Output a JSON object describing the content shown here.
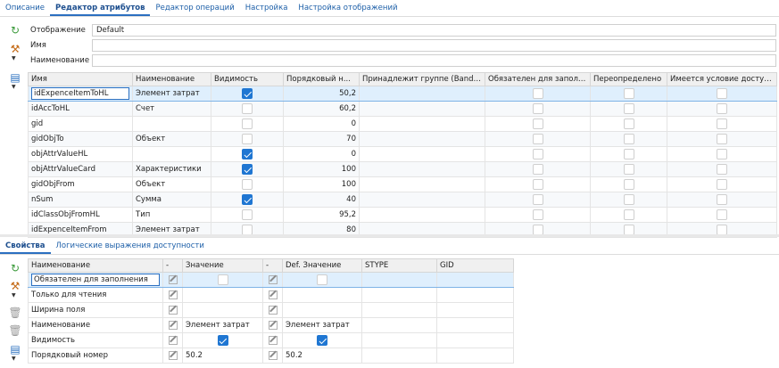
{
  "top_tabs": [
    {
      "label": "Описание",
      "active": false
    },
    {
      "label": "Редактор атрибутов",
      "active": true
    },
    {
      "label": "Редактор операций",
      "active": false
    },
    {
      "label": "Настройка",
      "active": false
    },
    {
      "label": "Настройка отображений",
      "active": false
    }
  ],
  "form": {
    "display_label": "Отображение",
    "display_value": "Default",
    "name_label": "Имя",
    "name_value": "",
    "title_label": "Наименование",
    "title_value": ""
  },
  "toolbar_top": {
    "icons": [
      "refresh-icon",
      "tools-icon",
      "export-icon"
    ]
  },
  "attr_grid": {
    "columns": [
      "Имя",
      "Наименование",
      "Видимость",
      "Порядковый н...",
      "Принадлежит группе (BandGr...",
      "Обязателен для заполне...",
      "Переопределено",
      "Имеется условие доступн..."
    ],
    "rows": [
      {
        "name": "idExpenceItemToHL",
        "title": "Элемент затрат",
        "visible": true,
        "order": "50,2"
      },
      {
        "name": "idAccToHL",
        "title": "Счет",
        "visible": false,
        "order": "60,2"
      },
      {
        "name": "gid",
        "title": "",
        "visible": false,
        "order": "0"
      },
      {
        "name": "gidObjTo",
        "title": "Объект",
        "visible": false,
        "order": "70"
      },
      {
        "name": "objAttrValueHL",
        "title": "",
        "visible": true,
        "order": "0"
      },
      {
        "name": "objAttrValueCard",
        "title": "Характеристики",
        "visible": true,
        "order": "100"
      },
      {
        "name": "gidObjFrom",
        "title": "Объект",
        "visible": false,
        "order": "100"
      },
      {
        "name": "nSum",
        "title": "Сумма",
        "visible": true,
        "order": "40"
      },
      {
        "name": "idClassObjFromHL",
        "title": "Тип",
        "visible": false,
        "order": "95,2"
      },
      {
        "name": "idExpenceItemFrom",
        "title": "Элемент затрат",
        "visible": false,
        "order": "80"
      }
    ]
  },
  "bottom_tabs": [
    {
      "label": "Свойства",
      "active": true
    },
    {
      "label": "Логические выражения доступности",
      "active": false
    }
  ],
  "toolbar_bottom": {
    "icons": [
      "refresh-icon",
      "tools-icon",
      "trash-icon",
      "trash-icon",
      "export-icon"
    ]
  },
  "props_grid": {
    "columns": [
      "Наименование",
      "-",
      "Значение",
      "-",
      "Def. Значение",
      "STYPE",
      "GID"
    ],
    "rows": [
      {
        "name": "Обязателен для заполнения",
        "value_type": "checkbox",
        "value": false,
        "def_type": "checkbox",
        "def": false
      },
      {
        "name": "Только для чтения",
        "value_type": "text",
        "value": "",
        "def_type": "text",
        "def": ""
      },
      {
        "name": "Ширина поля",
        "value_type": "text",
        "value": "",
        "def_type": "text",
        "def": ""
      },
      {
        "name": "Наименование",
        "value_type": "text",
        "value": "Элемент затрат",
        "def_type": "text",
        "def": "Элемент затрат"
      },
      {
        "name": "Видимость",
        "value_type": "checkbox",
        "value": true,
        "def_type": "checkbox",
        "def": true
      },
      {
        "name": "Порядковый номер",
        "value_type": "text",
        "value": "50.2",
        "def_type": "text",
        "def": "50.2"
      }
    ]
  },
  "colors": {
    "accent": "#1f76d2",
    "tab_text": "#1d5fa8",
    "selection": "#dfeffd"
  }
}
